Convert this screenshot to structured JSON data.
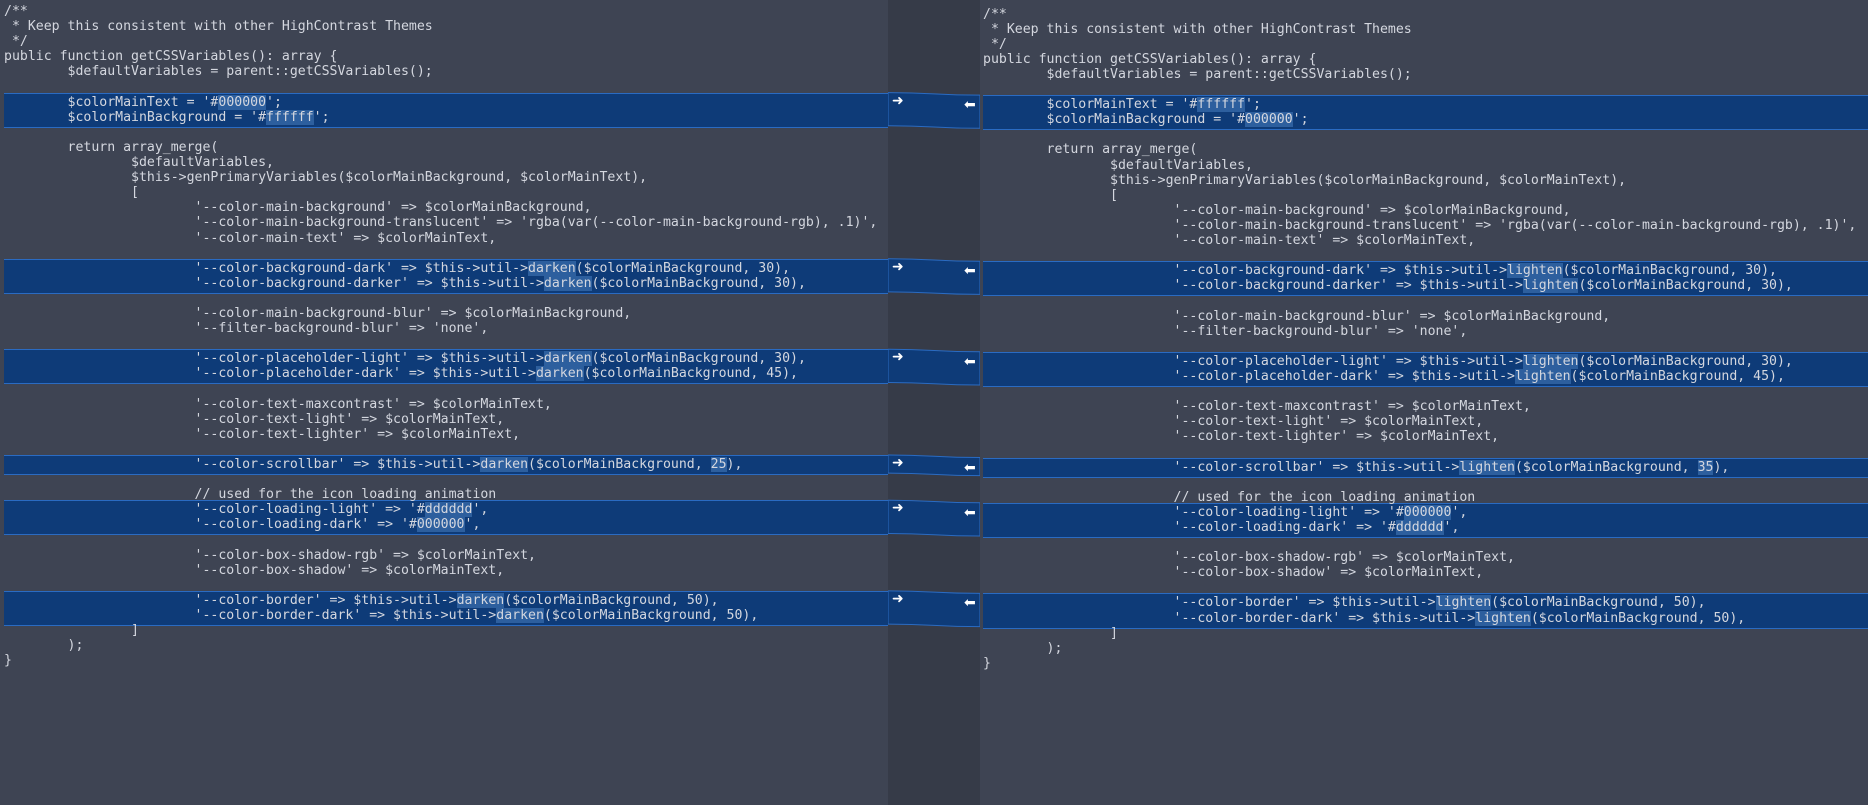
{
  "left": {
    "lines": [
      "/**",
      " * Keep this consistent with other HighContrast Themes",
      " */",
      "public function getCSSVariables(): array {",
      "        $defaultVariables = parent::getCSSVariables();",
      "",
      "        $colorMainText = '#000000';",
      "        $colorMainBackground = '#ffffff';",
      "",
      "        return array_merge(",
      "                $defaultVariables,",
      "                $this->genPrimaryVariables($colorMainBackground, $colorMainText),",
      "                [",
      "                        '--color-main-background' => $colorMainBackground,",
      "                        '--color-main-background-translucent' => 'rgba(var(--color-main-background-rgb), .1)',",
      "                        '--color-main-text' => $colorMainText,",
      "",
      "                        '--color-background-dark' => $this->util->darken($colorMainBackground, 30),",
      "                        '--color-background-darker' => $this->util->darken($colorMainBackground, 30),",
      "",
      "                        '--color-main-background-blur' => $colorMainBackground,",
      "                        '--filter-background-blur' => 'none',",
      "",
      "                        '--color-placeholder-light' => $this->util->darken($colorMainBackground, 30),",
      "                        '--color-placeholder-dark' => $this->util->darken($colorMainBackground, 45),",
      "",
      "                        '--color-text-maxcontrast' => $colorMainText,",
      "                        '--color-text-light' => $colorMainText,",
      "                        '--color-text-lighter' => $colorMainText,",
      "",
      "                        '--color-scrollbar' => $this->util->darken($colorMainBackground, 25),",
      "",
      "                        // used for the icon loading animation",
      "                        '--color-loading-light' => '#dddddd',",
      "                        '--color-loading-dark' => '#000000',",
      "",
      "                        '--color-box-shadow-rgb' => $colorMainText,",
      "                        '--color-box-shadow' => $colorMainText,",
      "",
      "                        '--color-border' => $this->util->darken($colorMainBackground, 50),",
      "                        '--color-border-dark' => $this->util->darken($colorMainBackground, 50),",
      "                ]",
      "        );",
      "}"
    ]
  },
  "right": {
    "lines": [
      "/**",
      " * Keep this consistent with other HighContrast Themes",
      " */",
      "public function getCSSVariables(): array {",
      "        $defaultVariables = parent::getCSSVariables();",
      "",
      "        $colorMainText = '#ffffff';",
      "        $colorMainBackground = '#000000';",
      "",
      "        return array_merge(",
      "                $defaultVariables,",
      "                $this->genPrimaryVariables($colorMainBackground, $colorMainText),",
      "                [",
      "                        '--color-main-background' => $colorMainBackground,",
      "                        '--color-main-background-translucent' => 'rgba(var(--color-main-background-rgb), .1)',",
      "                        '--color-main-text' => $colorMainText,",
      "",
      "                        '--color-background-dark' => $this->util->lighten($colorMainBackground, 30),",
      "                        '--color-background-darker' => $this->util->lighten($colorMainBackground, 30),",
      "",
      "                        '--color-main-background-blur' => $colorMainBackground,",
      "                        '--filter-background-blur' => 'none',",
      "",
      "                        '--color-placeholder-light' => $this->util->lighten($colorMainBackground, 30),",
      "                        '--color-placeholder-dark' => $this->util->lighten($colorMainBackground, 45),",
      "",
      "                        '--color-text-maxcontrast' => $colorMainText,",
      "                        '--color-text-light' => $colorMainText,",
      "                        '--color-text-lighter' => $colorMainText,",
      "",
      "                        '--color-scrollbar' => $this->util->lighten($colorMainBackground, 35),",
      "",
      "                        // used for the icon loading animation",
      "                        '--color-loading-light' => '#000000',",
      "                        '--color-loading-dark' => '#dddddd',",
      "",
      "                        '--color-box-shadow-rgb' => $colorMainText,",
      "                        '--color-box-shadow' => $colorMainText,",
      "",
      "                        '--color-border' => $this->util->lighten($colorMainBackground, 50),",
      "                        '--color-border-dark' => $this->util->lighten($colorMainBackground, 50),",
      "                ]",
      "        );",
      "}"
    ]
  },
  "hunks": [
    {
      "lines": [
        6,
        7
      ],
      "left_words": [
        "000000",
        "ffffff"
      ],
      "right_words": [
        "ffffff",
        "000000"
      ]
    },
    {
      "lines": [
        17,
        18
      ],
      "left_words": [
        "darken",
        "darken"
      ],
      "right_words": [
        "lighten",
        "lighten"
      ]
    },
    {
      "lines": [
        23,
        24
      ],
      "left_words": [
        "darken",
        "darken"
      ],
      "right_words": [
        "lighten",
        "lighten"
      ]
    },
    {
      "lines": [
        30
      ],
      "left_words": [
        "darken",
        "25"
      ],
      "right_words": [
        "lighten",
        "35"
      ]
    },
    {
      "lines": [
        33,
        34
      ],
      "left_words": [
        "dddddd",
        "000000"
      ],
      "right_words": [
        "000000",
        "dddddd"
      ]
    },
    {
      "lines": [
        39,
        40
      ],
      "left_words": [
        "darken",
        "darken"
      ],
      "right_words": [
        "lighten",
        "lighten"
      ]
    }
  ],
  "colors": {
    "background": "#3e4453",
    "gutter": "#363b48",
    "change_block": "#0e3b78",
    "change_border": "#2a6bc2",
    "word_highlight": "#2d5f9e",
    "text": "#d4d7df"
  },
  "icons": {
    "copy_to_right": "arrow-right-icon",
    "copy_to_left": "arrow-left-icon"
  }
}
